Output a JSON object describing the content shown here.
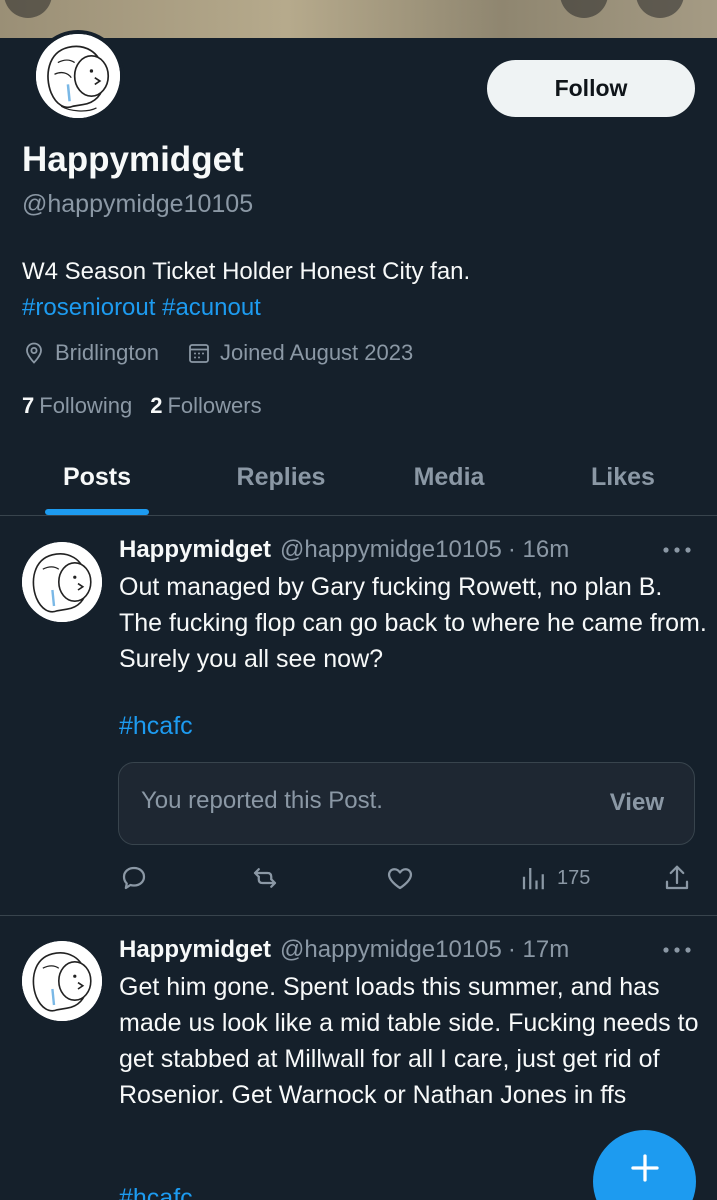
{
  "profile": {
    "name": "Happymidget",
    "handle": "@happymidge10105",
    "bio": "W4 Season Ticket Holder Honest City fan.",
    "bio_tags": [
      "#roseniorout",
      "#acunout"
    ],
    "location": "Bridlington",
    "joined": "Joined August 2023",
    "following_count": "7",
    "following_label": "Following",
    "followers_count": "2",
    "followers_label": "Followers",
    "follow_label": "Follow"
  },
  "tabs": [
    {
      "label": "Posts",
      "active": true
    },
    {
      "label": "Replies",
      "active": false
    },
    {
      "label": "Media",
      "active": false
    },
    {
      "label": "Likes",
      "active": false
    }
  ],
  "posts": [
    {
      "name": "Happymidget",
      "handle": "@happymidge10105",
      "time": "· 16m",
      "text": "Out managed by Gary fucking Rowett, no plan B. The fucking flop can go back to where he came from. Surely you all see now?",
      "tag": "#hcafc",
      "report_text": "You reported this Post.",
      "report_view": "View",
      "views": "175"
    },
    {
      "name": "Happymidget",
      "handle": "@happymidge10105",
      "time": "· 17m",
      "text": "Get him gone. Spent loads this summer, and has made us look like a mid table side. Fucking needs to get stabbed at Millwall for all I care, just get rid of Rosenior. Get Warnock or Nathan Jones in ffs",
      "tag": "#hcafc"
    }
  ],
  "colors": {
    "background": "#15202b",
    "accent": "#1d9bf0",
    "muted": "#8b98a5",
    "text": "#f7f9f9"
  },
  "icons": {
    "location": "location-pin-icon",
    "calendar": "calendar-icon",
    "reply": "reply-icon",
    "repost": "repost-icon",
    "like": "heart-icon",
    "views": "analytics-icon",
    "share": "share-icon",
    "more": "more-icon",
    "compose": "plus-icon"
  }
}
